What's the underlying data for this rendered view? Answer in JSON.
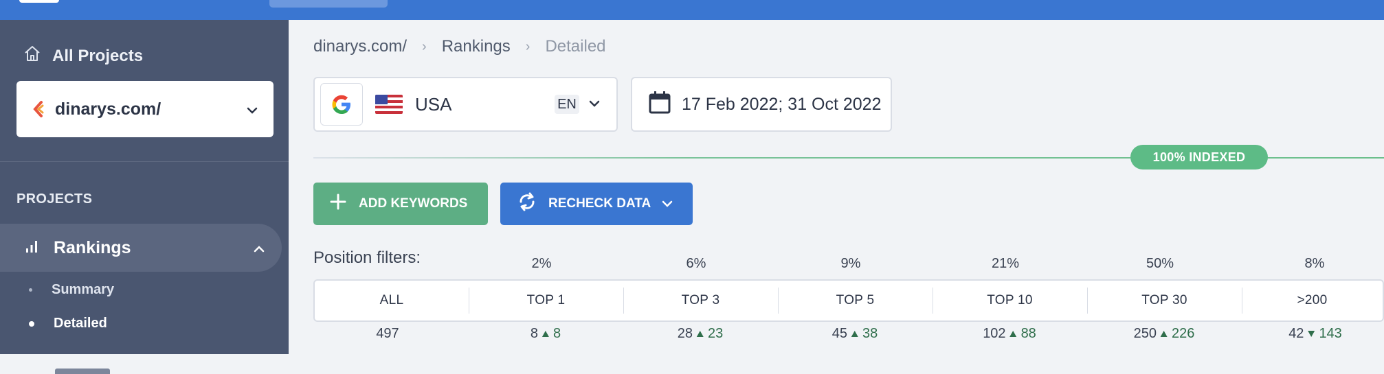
{
  "sidebar": {
    "all_projects_label": "All Projects",
    "project_name": "dinarys.com/",
    "section_label": "PROJECTS",
    "rankings_label": "Rankings",
    "sub_items": [
      {
        "label": "Summary",
        "active": false
      },
      {
        "label": "Detailed",
        "active": true
      }
    ]
  },
  "breadcrumb": {
    "items": [
      "dinarys.com/",
      "Rankings",
      "Detailed"
    ]
  },
  "engine": {
    "country": "USA",
    "language": "EN",
    "engine_icon": "google-icon"
  },
  "date_range": "17 Feb 2022; 31 Oct 2022",
  "indexed_badge": "100% INDEXED",
  "buttons": {
    "add_keywords": "ADD KEYWORDS",
    "recheck_data": "RECHECK DATA"
  },
  "position_filters": {
    "label": "Position filters:",
    "filters": [
      {
        "name": "ALL",
        "percent": "",
        "count": "497",
        "delta": "",
        "direction": ""
      },
      {
        "name": "TOP 1",
        "percent": "2%",
        "count": "8",
        "delta": "8",
        "direction": "up"
      },
      {
        "name": "TOP 3",
        "percent": "6%",
        "count": "28",
        "delta": "23",
        "direction": "up"
      },
      {
        "name": "TOP 5",
        "percent": "9%",
        "count": "45",
        "delta": "38",
        "direction": "up"
      },
      {
        "name": "TOP 10",
        "percent": "21%",
        "count": "102",
        "delta": "88",
        "direction": "up"
      },
      {
        "name": "TOP 30",
        "percent": "50%",
        "count": "250",
        "delta": "226",
        "direction": "up"
      },
      {
        "name": ">200",
        "percent": "8%",
        "count": "42",
        "delta": "143",
        "direction": "down"
      }
    ]
  },
  "colors": {
    "topbar": "#3a76d1",
    "sidebar": "#4a5670",
    "accent_green": "#5dae84",
    "accent_blue": "#3a76d1"
  }
}
